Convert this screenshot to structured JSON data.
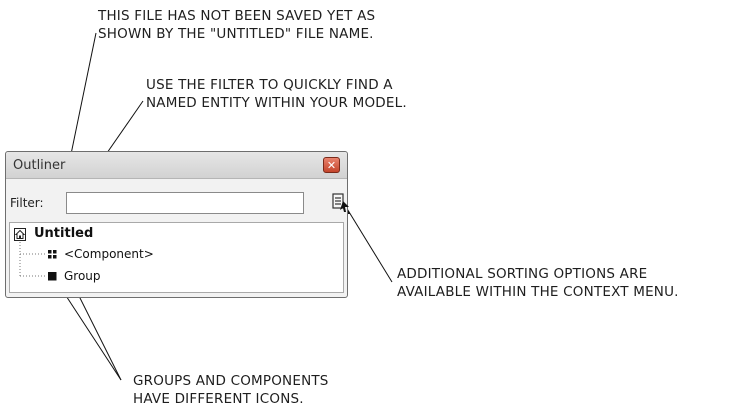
{
  "annotations": {
    "untitled_note": [
      "THIS FILE HAS NOT BEEN SAVED YET AS",
      "SHOWN BY THE \"UNTITLED\" FILE NAME."
    ],
    "filter_note": [
      "USE THE FILTER TO QUICKLY FIND A",
      "NAMED ENTITY WITHIN YOUR MODEL."
    ],
    "sorting_note": [
      "ADDITIONAL SORTING OPTIONS ARE",
      "AVAILABLE WITHIN THE CONTEXT MENU."
    ],
    "icons_note": [
      "GROUPS AND COMPONENTS",
      "HAVE DIFFERENT ICONS."
    ]
  },
  "outliner": {
    "title": "Outliner",
    "close_icon": "close-icon",
    "filter": {
      "label": "Filter:",
      "value": "",
      "placeholder": ""
    },
    "menu_icon": "details-menu-icon",
    "tree": {
      "root": {
        "label": "Untitled",
        "icon": "model-home-icon"
      },
      "items": [
        {
          "label": "<Component>",
          "icon": "component-icon"
        },
        {
          "label": "Group",
          "icon": "group-icon"
        }
      ]
    }
  },
  "colors": {
    "close_button": "#d0563c",
    "title_bar": "#dcdcdc",
    "annotation_text": "#1e1e1e"
  }
}
